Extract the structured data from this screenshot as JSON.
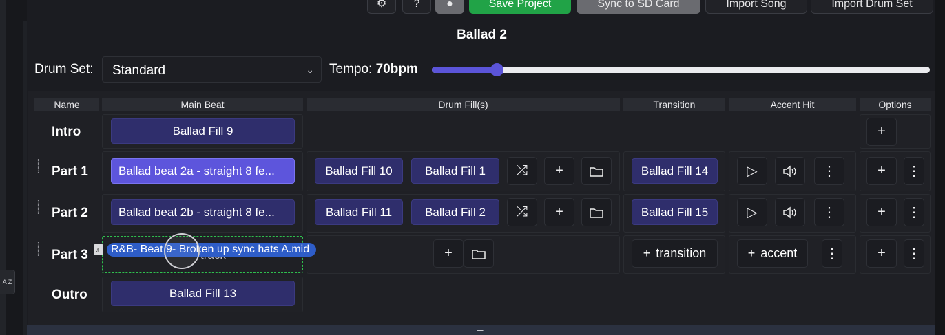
{
  "toolbar": {
    "save_project": "Save Project",
    "sync_sd": "Sync to SD Card",
    "import_song": "Import Song",
    "import_drum_set": "Import Drum Set"
  },
  "sidebar": {
    "sort_label": "A Z"
  },
  "song": {
    "title": "Ballad 2"
  },
  "drum_set": {
    "label": "Drum Set:",
    "selected": "Standard"
  },
  "tempo": {
    "label": "Tempo:",
    "value_text": "70bpm",
    "bpm": 70,
    "fraction": 0.13
  },
  "columns": {
    "name": "Name",
    "main_beat": "Main Beat",
    "drum_fills": "Drum Fill(s)",
    "transition": "Transition",
    "accent_hit": "Accent Hit",
    "options": "Options"
  },
  "rows": [
    {
      "name": "Intro",
      "main_beat": "Ballad Fill 9"
    },
    {
      "name": "Part 1",
      "main_beat": "Ballad beat 2a - straight 8 fe...",
      "fills": [
        "Ballad Fill 10",
        "Ballad Fill 1"
      ],
      "transition": "Ballad Fill 14"
    },
    {
      "name": "Part 2",
      "main_beat": "Ballad beat 2b - straight 8 fe...",
      "fills": [
        "Ballad Fill 11",
        "Ballad Fill 2"
      ],
      "transition": "Ballad Fill 15"
    },
    {
      "name": "Part 3",
      "main_beat_placeholder": "track",
      "transition_add": "transition",
      "accent_add": "accent"
    },
    {
      "name": "Outro",
      "main_beat": "Ballad Fill 13"
    }
  ],
  "drag": {
    "file": "R&B- Beat 9- Broken up sync hats A.mid"
  },
  "icons": {
    "add": "+",
    "shuffle": "⤮",
    "folder": "folder-icon",
    "play": "▷",
    "volume": "volume-icon",
    "more": "⋮"
  },
  "colors": {
    "accent": "#5b54d9",
    "beat": "#2f2e6c",
    "active_beat": "#5d55dc",
    "save": "#21a347",
    "drag_chip": "#2e5dc8"
  }
}
